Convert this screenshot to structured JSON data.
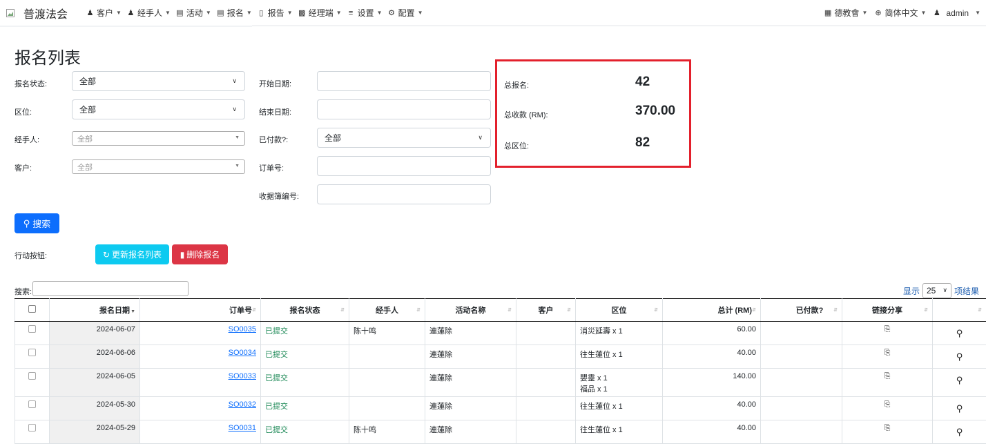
{
  "navbar": {
    "brand": "普渡法会",
    "menu": [
      {
        "label": "客户",
        "icon": "users-icon"
      },
      {
        "label": "经手人",
        "icon": "user-icon"
      },
      {
        "label": "活动",
        "icon": "map-icon"
      },
      {
        "label": "报名",
        "icon": "list-icon"
      },
      {
        "label": "报告",
        "icon": "file-icon"
      },
      {
        "label": "经理端",
        "icon": "briefcase-icon"
      },
      {
        "label": "设置",
        "icon": "sliders-icon"
      },
      {
        "label": "配置",
        "icon": "gear-icon"
      }
    ],
    "right": [
      {
        "label": "德教會",
        "icon": "building-icon"
      },
      {
        "label": "简体中文",
        "icon": "globe-icon"
      },
      {
        "label": "admin",
        "icon": "user-icon"
      }
    ]
  },
  "page_title": "报名列表",
  "filters": {
    "status": {
      "label": "报名状态:",
      "value": "全部"
    },
    "zone": {
      "label": "区位:",
      "value": "全部"
    },
    "agent": {
      "label": "经手人:",
      "placeholder": "全部"
    },
    "customer": {
      "label": "客户:",
      "placeholder": "全部"
    },
    "start_date": {
      "label": "开始日期:",
      "value": ""
    },
    "end_date": {
      "label": "结束日期:",
      "value": ""
    },
    "paid": {
      "label": "已付款?:",
      "value": "全部"
    },
    "order_no": {
      "label": "订单号:",
      "value": ""
    },
    "receipt_no": {
      "label": "收据簿编号:",
      "value": ""
    }
  },
  "summary": {
    "total_reg_label": "总报名:",
    "total_reg": "42",
    "total_income_label": "总收款 (RM):",
    "total_income": "370.00",
    "total_zone_label": "总区位:",
    "total_zone": "82"
  },
  "buttons": {
    "search": "搜索",
    "actions_label": "行动按钮:",
    "refresh": "更新报名列表",
    "delete": "删除报名"
  },
  "datatable": {
    "search_label": "搜索:",
    "length_prefix": "显示",
    "length_value": "25",
    "length_suffix": "项结果"
  },
  "table": {
    "headers": [
      "报名日期",
      "订单号",
      "报名状态",
      "经手人",
      "活动名称",
      "客户",
      "区位",
      "总计 (RM)",
      "已付款?",
      "链接分享"
    ],
    "rows": [
      {
        "date": "2024-06-07",
        "order": "SO0035",
        "status": "已提交",
        "agent": "陈十鸣",
        "event": "連蓮除",
        "customer": "",
        "zone": [
          "消災延壽 x 1"
        ],
        "total": "60.00",
        "paid": ""
      },
      {
        "date": "2024-06-06",
        "order": "SO0034",
        "status": "已提交",
        "agent": "",
        "event": "連蓮除",
        "customer": "",
        "zone": [
          "往生蓮位 x 1"
        ],
        "total": "40.00",
        "paid": ""
      },
      {
        "date": "2024-06-05",
        "order": "SO0033",
        "status": "已提交",
        "agent": "",
        "event": "連蓮除",
        "customer": "",
        "zone": [
          "嬰靈 x 1",
          "福品 x 1"
        ],
        "total": "140.00",
        "paid": ""
      },
      {
        "date": "2024-05-30",
        "order": "SO0032",
        "status": "已提交",
        "agent": "",
        "event": "連蓮除",
        "customer": "",
        "zone": [
          "往生蓮位 x 1"
        ],
        "total": "40.00",
        "paid": ""
      },
      {
        "date": "2024-05-29",
        "order": "SO0031",
        "status": "已提交",
        "agent": "陈十鸣",
        "event": "連蓮除",
        "customer": "",
        "zone": [
          "往生蓮位 x 1"
        ],
        "total": "40.00",
        "paid": ""
      }
    ]
  }
}
